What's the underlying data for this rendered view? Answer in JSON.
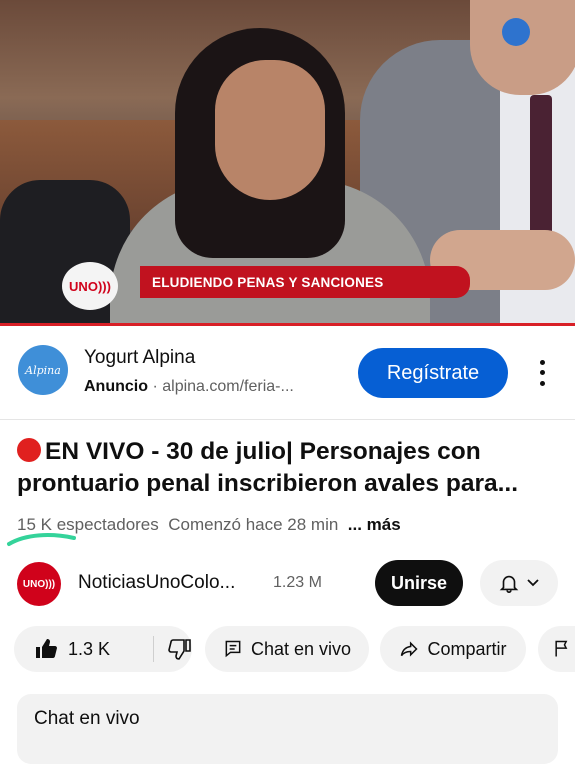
{
  "video": {
    "lower_third": "ELUDIENDO PENAS Y SANCIONES",
    "channel_bug": "UNO",
    "progress": 1.0,
    "progress_color": "#d81f26"
  },
  "ad": {
    "brand_logo_text": "Alpina",
    "title": "Yogurt Alpina",
    "label": "Anuncio",
    "separator": "·",
    "url": "alpina.com/feria-...",
    "cta": "Regístrate",
    "cta_color": "#065fd4"
  },
  "video_info": {
    "title": "EN VIVO - 30 de julio| Personajes con prontuario penal inscribieron avales para...",
    "viewers": "15 K espectadores",
    "started": "Comenzó hace 28 min",
    "more": "... más"
  },
  "channel": {
    "logo_text": "UNO",
    "name": "NoticiasUnoColo...",
    "subscribers": "1.23 M",
    "join": "Unirse"
  },
  "actions": {
    "likes": "1.3 K",
    "chat": "Chat en vivo",
    "share": "Compartir"
  },
  "live_chat": {
    "header": "Chat en vivo"
  },
  "icons": [
    "like-icon",
    "dislike-icon",
    "chat-icon",
    "share-icon",
    "flag-icon",
    "bell-icon",
    "chevron-down-icon",
    "kebab-icon",
    "live-dot-icon"
  ]
}
